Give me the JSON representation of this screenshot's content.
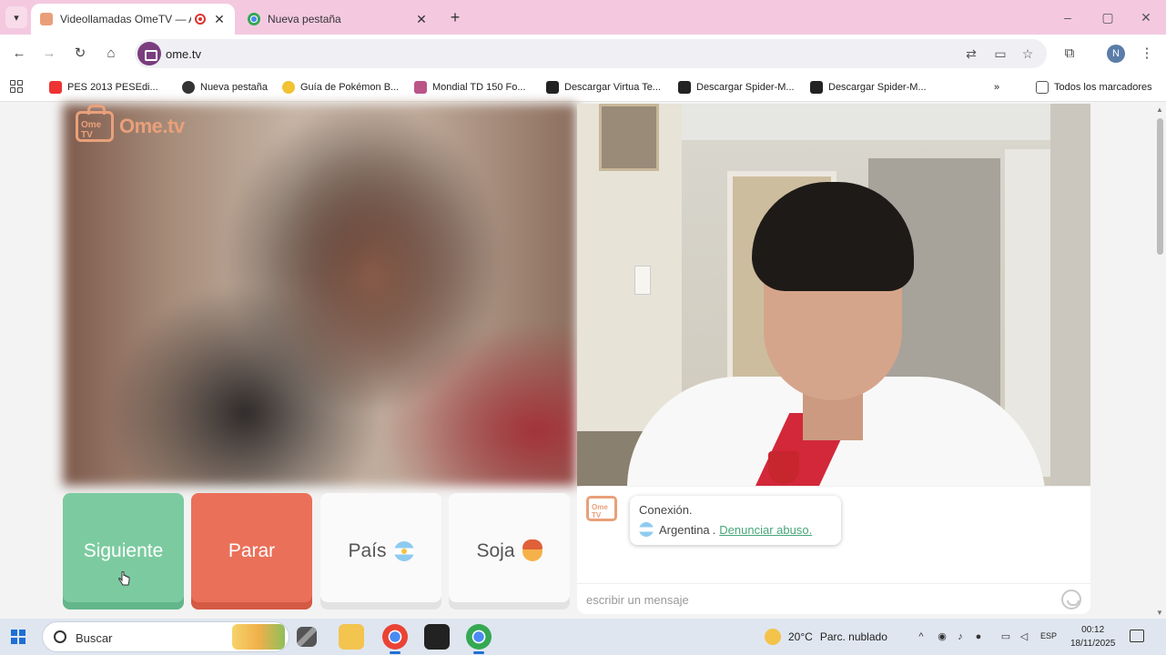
{
  "browser": {
    "tabs": [
      {
        "title": "Videollamadas OmeTV — A",
        "active": true
      },
      {
        "title": "Nueva pestaña",
        "active": false
      }
    ],
    "url": "ome.tv",
    "profile_initial": "N",
    "window_controls": {
      "minimize": "–",
      "maximize": "▢",
      "close": "✕"
    }
  },
  "bookmarks": [
    {
      "label": "PES 2013 PESEdi..."
    },
    {
      "label": "Nueva pestaña"
    },
    {
      "label": "Guía de Pokémon B..."
    },
    {
      "label": "Mondial TD 150 Fo..."
    },
    {
      "label": "Descargar Virtua Te..."
    },
    {
      "label": "Descargar Spider-M..."
    },
    {
      "label": "Descargar Spider-M..."
    }
  ],
  "bookmarks_overflow": "»",
  "all_bookmarks_label": "Todos los marcadores",
  "ometv": {
    "logo_text": "Ome.tv",
    "logo_cam_text": "Ome TV",
    "buttons": {
      "next": "Siguiente",
      "stop": "Parar",
      "country": "País",
      "gender": "Soja"
    },
    "chat": {
      "status_line": "Conexión.",
      "country": "Argentina",
      "separator": ".",
      "report_link": "Denunciar abuso.",
      "input_placeholder": "escribir un mensaje"
    }
  },
  "taskbar": {
    "search_label": "Buscar",
    "weather_temp": "20°C",
    "weather_desc": "Parc. nublado",
    "language": "ESP",
    "time": "00:12",
    "date": "18/11/2025"
  },
  "colors": {
    "tab_strip": "#f4c9e0",
    "next_button": "#7ccba0",
    "stop_button": "#ea7059",
    "link": "#47a67a",
    "ome_brand": "#e9a07a"
  }
}
